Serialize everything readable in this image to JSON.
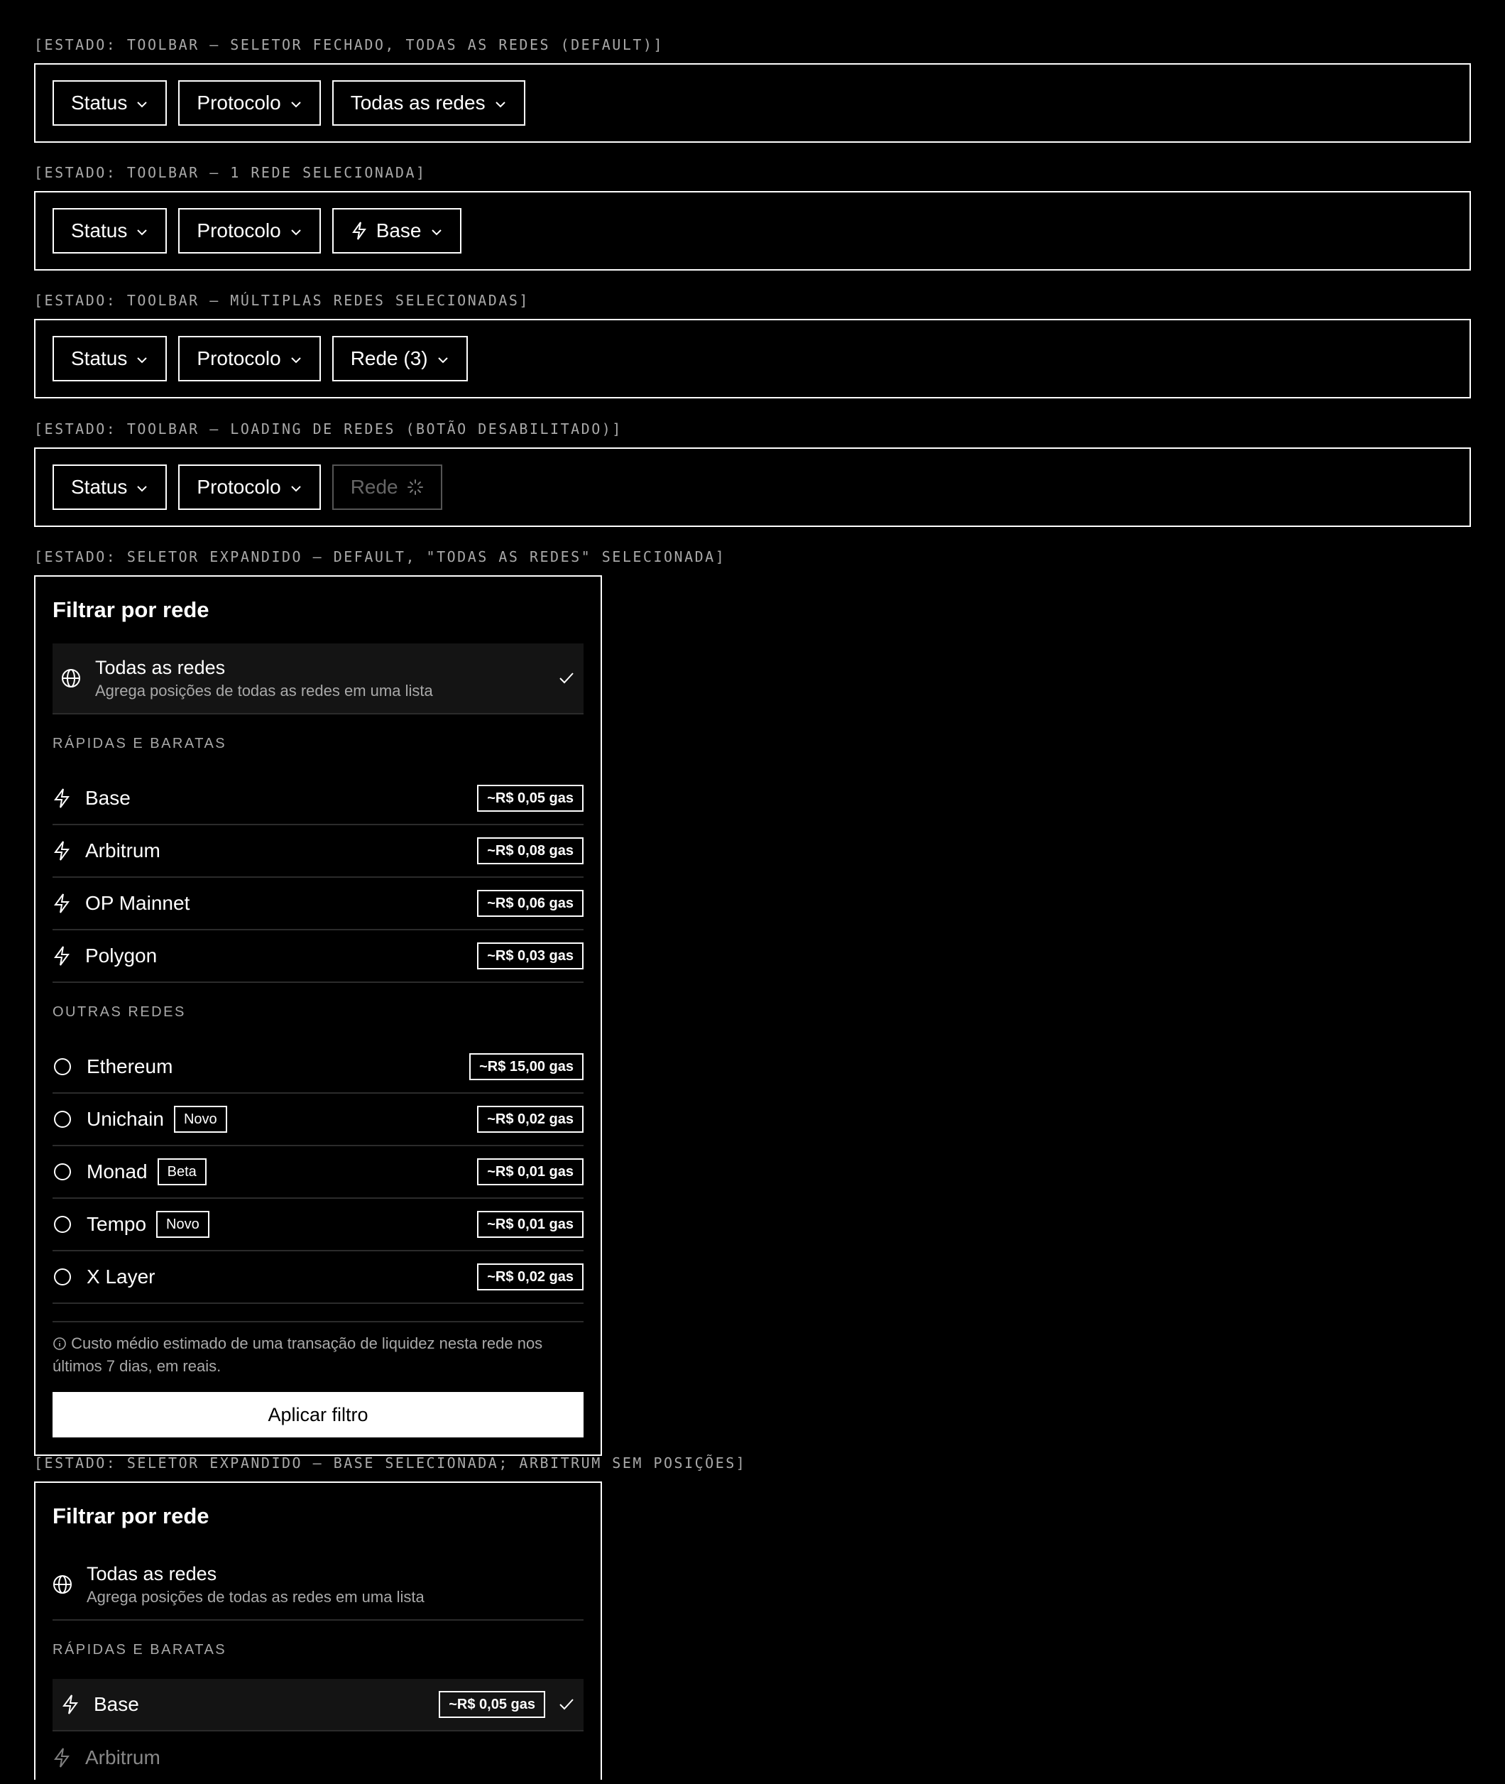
{
  "toolbar_states": [
    {
      "label": "[ESTADO: TOOLBAR — SELETOR FECHADO, TODAS AS REDES (DEFAULT)]",
      "status": "Status",
      "protocolo": "Protocolo",
      "rede": "Todas as redes"
    },
    {
      "label": "[ESTADO: TOOLBAR — 1 REDE SELECIONADA]",
      "status": "Status",
      "protocolo": "Protocolo",
      "rede": "Base"
    },
    {
      "label": "[ESTADO: TOOLBAR — MÚLTIPLAS REDES SELECIONADAS]",
      "status": "Status",
      "protocolo": "Protocolo",
      "rede": "Rede (3)"
    },
    {
      "label": "[ESTADO: TOOLBAR — LOADING DE REDES (BOTÃO DESABILITADO)]",
      "status": "Status",
      "protocolo": "Protocolo",
      "rede": "Rede"
    }
  ],
  "panel1": {
    "label": "[ESTADO: SELETOR EXPANDIDO — DEFAULT, \"TODAS AS REDES\" SELECIONADA]",
    "title": "Filtrar por rede",
    "all_title": "Todas as redes",
    "all_desc": "Agrega posições de todas as redes em uma lista",
    "group_fast": "RÁPIDAS E BARATAS",
    "fast": [
      {
        "name": "Base",
        "gas": "~R$ 0,05 gas"
      },
      {
        "name": "Arbitrum",
        "gas": "~R$ 0,08 gas"
      },
      {
        "name": "OP Mainnet",
        "gas": "~R$ 0,06 gas"
      },
      {
        "name": "Polygon",
        "gas": "~R$ 0,03 gas"
      }
    ],
    "group_other": "OUTRAS REDES",
    "other": [
      {
        "name": "Ethereum",
        "tag": "",
        "gas": "~R$ 15,00 gas"
      },
      {
        "name": "Unichain",
        "tag": "Novo",
        "gas": "~R$ 0,02 gas"
      },
      {
        "name": "Monad",
        "tag": "Beta",
        "gas": "~R$ 0,01 gas"
      },
      {
        "name": "Tempo",
        "tag": "Novo",
        "gas": "~R$ 0,01 gas"
      },
      {
        "name": "X Layer",
        "tag": "",
        "gas": "~R$ 0,02 gas"
      }
    ],
    "footnote": "Custo médio estimado de uma transação de liquidez nesta rede nos últimos 7 dias, em reais.",
    "apply": "Aplicar filtro"
  },
  "panel2": {
    "label": "[ESTADO: SELETOR EXPANDIDO — BASE SELECIONADA; ARBITRUM SEM POSIÇÕES]",
    "title": "Filtrar por rede",
    "all_title": "Todas as redes",
    "all_desc": "Agrega posições de todas as redes em uma lista",
    "group_fast": "RÁPIDAS E BARATAS",
    "selected_name": "Base",
    "selected_gas": "~R$ 0,05 gas",
    "next_name": "Arbitrum"
  }
}
